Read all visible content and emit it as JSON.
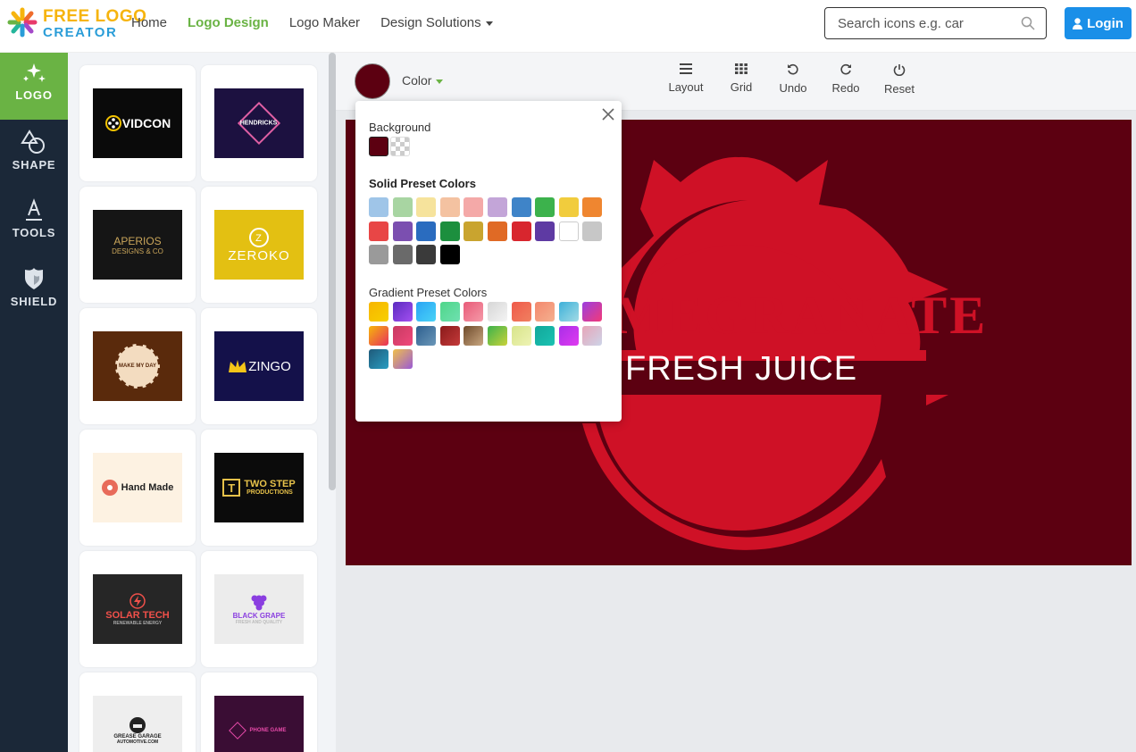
{
  "brand": {
    "line1": "FREE LOGO",
    "line2": "CREATOR"
  },
  "nav": {
    "items": [
      "Home",
      "Logo Design",
      "Logo Maker",
      "Design Solutions"
    ],
    "active": "Logo Design"
  },
  "search": {
    "placeholder": "Search icons e.g. car"
  },
  "login": {
    "label": "Login"
  },
  "sidebar": {
    "items": [
      {
        "label": "LOGO",
        "icon": "sparkles-icon",
        "active": true
      },
      {
        "label": "SHAPE",
        "icon": "shapes-icon"
      },
      {
        "label": "TOOLS",
        "icon": "text-tool-icon"
      },
      {
        "label": "SHIELD",
        "icon": "shield-icon"
      }
    ]
  },
  "gallery": {
    "items": [
      {
        "text": "VIDCON",
        "bg": "#0a0a0a",
        "fg": "#ffffff"
      },
      {
        "text": "HENDRICKS",
        "bg": "#1c1140",
        "fg": "#e05fa4"
      },
      {
        "text": "APERIOS",
        "sub": "DESIGNS & CO",
        "bg": "#151515",
        "fg": "#c9a55a"
      },
      {
        "text": "ZEROKO",
        "bg": "#e3c012",
        "fg": "#ffffff"
      },
      {
        "text": "MAKE MY DAY",
        "bg": "#5a2a0c",
        "fg": "#f3dcc0"
      },
      {
        "text": "ZINGO",
        "bg": "#14114a",
        "fg": "#ffffff"
      },
      {
        "text": "Hand Made",
        "bg": "#fdf2e2",
        "fg": "#222222"
      },
      {
        "text": "TWO STEP",
        "sub": "PRODUCTIONS",
        "bg": "#0b0b0b",
        "fg": "#e6c14a"
      },
      {
        "text": "SOLAR TECH",
        "sub": "RENEWABLE ENERGY",
        "bg": "#262626",
        "fg": "#f0504a"
      },
      {
        "text": "BLACK GRAPE",
        "sub": "FRESH AND QUALITY",
        "bg": "#ececec",
        "fg": "#8a3ee0"
      },
      {
        "text": "GREASE GARAGE",
        "sub": "AUTOMOTIVE.COM",
        "bg": "#eeeeee",
        "fg": "#222222"
      },
      {
        "text": "PHONE GAME",
        "bg": "#3a0d34",
        "fg": "#e64aa9"
      }
    ]
  },
  "toolbar": {
    "current_color": "#5c0011",
    "color_label": "Color",
    "tools": [
      {
        "label": "Layout",
        "icon": "list-icon"
      },
      {
        "label": "Grid",
        "icon": "grid-icon"
      },
      {
        "label": "Undo",
        "icon": "undo-icon"
      },
      {
        "label": "Redo",
        "icon": "redo-icon"
      },
      {
        "label": "Reset",
        "icon": "power-icon"
      }
    ]
  },
  "canvas": {
    "bg": "#5c0011",
    "fruit": "#cf1126",
    "title": "MEGRANATE",
    "subtitle": "FRESH JUICE"
  },
  "color_popup": {
    "background_label": "Background",
    "background_options": [
      "#5c0011",
      "transparent"
    ],
    "solid_label": "Solid Preset Colors",
    "solid": [
      "#9fc5e8",
      "#a8d5a2",
      "#f6e39c",
      "#f4c2a1",
      "#f4a9a8",
      "#c3a5d8",
      "#3f84c8",
      "#3cb24c",
      "#f1cc3d",
      "#ef8630",
      "#e84646",
      "#7b4fb0",
      "#2a6cbf",
      "#1c8f3e",
      "#c9a42f",
      "#e06a25",
      "#d8262e",
      "#5e3aa3",
      "#ffffff",
      "#c7c7c7",
      "#9a9a9a",
      "#6a6a6a",
      "#3a3a3a",
      "#000000"
    ],
    "gradient_label": "Gradient Preset Colors",
    "gradients": [
      [
        "#f7b500",
        "#f7d000"
      ],
      [
        "#5b2bc0",
        "#a34ff0"
      ],
      [
        "#2aa4f4",
        "#49d3f7"
      ],
      [
        "#4fd68a",
        "#6fe0b0"
      ],
      [
        "#e85a78",
        "#f59aa8"
      ],
      [
        "#d6d6d6",
        "#f4f4f4"
      ],
      [
        "#ef5a4a",
        "#f08060"
      ],
      [
        "#f3886d",
        "#f5b08f"
      ],
      [
        "#3db0d9",
        "#a2dbe5"
      ],
      [
        "#9b3fe0",
        "#f23a78"
      ],
      [
        "#f6b60a",
        "#e8305c"
      ],
      [
        "#c73a62",
        "#f0487b"
      ],
      [
        "#2d5f8f",
        "#6b97b8"
      ],
      [
        "#8a1a1a",
        "#c43a3a"
      ],
      [
        "#6e4a2a",
        "#c9a781"
      ],
      [
        "#3cb24c",
        "#c9d23a"
      ],
      [
        "#d7e48a",
        "#eef3b4"
      ],
      [
        "#12a79a",
        "#1bc2b2"
      ],
      [
        "#a92ee8",
        "#e03bf0"
      ],
      [
        "#e7a5b8",
        "#cdd4e8"
      ],
      [
        "#1f5a7a",
        "#2a9dc1"
      ],
      [
        "#f0c04a",
        "#9a5ad6"
      ]
    ]
  }
}
